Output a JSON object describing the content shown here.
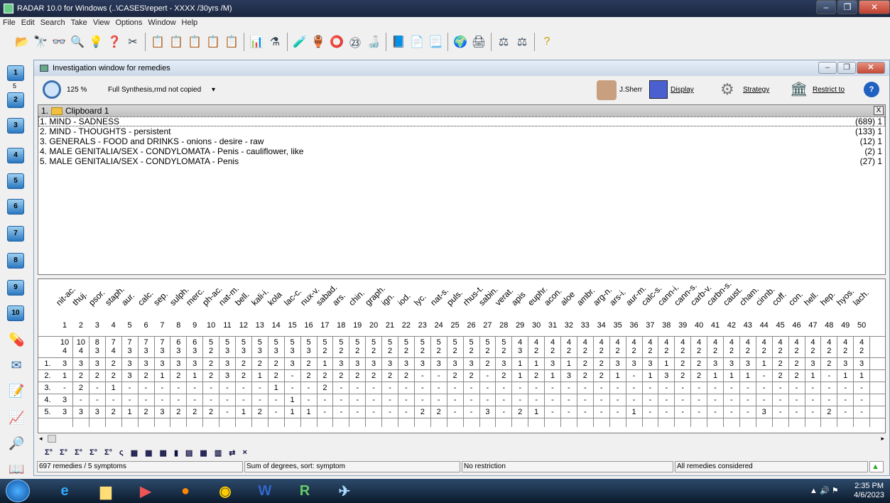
{
  "window": {
    "title": "RADAR 10.0 for Windows  (..\\CASES\\repert - XXXX /30yrs /M)"
  },
  "menu": [
    "File",
    "Edit",
    "Search",
    "Take",
    "View",
    "Options",
    "Window",
    "Help"
  ],
  "left_bar": {
    "clipboards": [
      "1",
      "2",
      "3",
      "4",
      "5",
      "6",
      "7",
      "8",
      "9",
      "10"
    ],
    "sub_label": "5"
  },
  "investigation": {
    "title": "Investigation window for remedies",
    "zoom": "125 %",
    "synthesis": "Full Synthesis,rmd not copied",
    "user": "J.Sherr",
    "display_label": "Display",
    "strategy_label": "Strategy",
    "restrict_label": "Restrict to"
  },
  "clipboard": {
    "header": "1.",
    "name": "Clipboard 1",
    "close": "X",
    "rubrics": [
      {
        "label": "1. MIND - SADNESS",
        "count": "(689) 1"
      },
      {
        "label": "2. MIND - THOUGHTS - persistent",
        "count": "(133) 1"
      },
      {
        "label": "3. GENERALS - FOOD and DRINKS - onions - desire - raw",
        "count": "(12) 1"
      },
      {
        "label": "4. MALE GENITALIA/SEX - CONDYLOMATA - Penis - cauliflower, like",
        "count": "(2) 1"
      },
      {
        "label": "5. MALE GENITALIA/SEX - CONDYLOMATA - Penis",
        "count": "(27) 1"
      }
    ]
  },
  "grid": {
    "remedies": [
      "nit-ac.",
      "thuj.",
      "psor.",
      "staph.",
      "aur.",
      "calc.",
      "sep.",
      "sulph.",
      "merc.",
      "ph-ac.",
      "nat-m.",
      "bell.",
      "kali-i.",
      "kola",
      "lac-c.",
      "nux-v.",
      "sabad.",
      "ars.",
      "chin.",
      "graph.",
      "ign.",
      "iod.",
      "lyc.",
      "nat-s.",
      "puls.",
      "rhus-t.",
      "sabin.",
      "verat.",
      "apis",
      "euphr.",
      "acon.",
      "aloe",
      "ambr.",
      "arg-n.",
      "ars-i.",
      "aur-m.",
      "calc-s.",
      "cann-i.",
      "cann-s.",
      "carb-v.",
      "carbn-s.",
      "caust.",
      "cham.",
      "cinnb.",
      "coff.",
      "con.",
      "hell.",
      "hep.",
      "hyos.",
      "lach."
    ],
    "numbers": [
      "1",
      "2",
      "3",
      "4",
      "5",
      "6",
      "7",
      "8",
      "9",
      "10",
      "11",
      "12",
      "13",
      "14",
      "15",
      "16",
      "17",
      "18",
      "19",
      "20",
      "21",
      "22",
      "23",
      "24",
      "25",
      "26",
      "27",
      "28",
      "29",
      "30",
      "31",
      "32",
      "33",
      "34",
      "35",
      "36",
      "37",
      "38",
      "39",
      "40",
      "41",
      "42",
      "43",
      "44",
      "45",
      "46",
      "47",
      "48",
      "49",
      "50"
    ],
    "sum_degrees": [
      "10",
      "10",
      "8",
      "7",
      "7",
      "7",
      "7",
      "6",
      "6",
      "5",
      "5",
      "5",
      "5",
      "5",
      "5",
      "5",
      "5",
      "5",
      "5",
      "5",
      "5",
      "5",
      "5",
      "5",
      "5",
      "5",
      "5",
      "5",
      "4",
      "4",
      "4",
      "4",
      "4",
      "4",
      "4",
      "4",
      "4",
      "4",
      "4",
      "4",
      "4",
      "4",
      "4",
      "4",
      "4",
      "4",
      "4",
      "4",
      "4",
      "4"
    ],
    "sum_symptoms": [
      "4",
      "4",
      "3",
      "4",
      "3",
      "3",
      "3",
      "3",
      "3",
      "2",
      "3",
      "3",
      "3",
      "3",
      "3",
      "3",
      "2",
      "2",
      "2",
      "2",
      "2",
      "2",
      "2",
      "2",
      "2",
      "2",
      "2",
      "2",
      "3",
      "2",
      "2",
      "2",
      "2",
      "2",
      "2",
      "2",
      "2",
      "2",
      "2",
      "2",
      "2",
      "2",
      "2",
      "2",
      "2",
      "2",
      "2",
      "2",
      "2",
      "2"
    ],
    "rows": [
      {
        "label": "1.",
        "cells": [
          "3",
          "3",
          "3",
          "2",
          "3",
          "3",
          "3",
          "3",
          "3",
          "2",
          "3",
          "2",
          "2",
          "2",
          "3",
          "2",
          "1",
          "3",
          "3",
          "3",
          "3",
          "3",
          "3",
          "3",
          "3",
          "3",
          "2",
          "3",
          "1",
          "1",
          "3",
          "1",
          "2",
          "2",
          "3",
          "3",
          "3",
          "1",
          "2",
          "2",
          "3",
          "3",
          "3",
          "1",
          "2",
          "2",
          "3",
          "2",
          "3",
          "3"
        ]
      },
      {
        "label": "2.",
        "cells": [
          "1",
          "2",
          "2",
          "2",
          "3",
          "2",
          "1",
          "2",
          "1",
          "2",
          "3",
          "2",
          "1",
          "2",
          "-",
          "2",
          "2",
          "2",
          "2",
          "2",
          "2",
          "2",
          "-",
          "-",
          "2",
          "2",
          "-",
          "2",
          "1",
          "2",
          "1",
          "3",
          "2",
          "2",
          "1",
          "-",
          "1",
          "3",
          "2",
          "2",
          "1",
          "1",
          "1",
          "-",
          "2",
          "2",
          "1",
          "-",
          "1",
          "1"
        ]
      },
      {
        "label": "3.",
        "cells": [
          "-",
          "2",
          "-",
          "1",
          "-",
          "-",
          "-",
          "-",
          "-",
          "-",
          "-",
          "-",
          "-",
          "1",
          "-",
          "-",
          "2",
          "-",
          "-",
          "-",
          "-",
          "-",
          "-",
          "-",
          "-",
          "-",
          "-",
          "-",
          "-",
          "-",
          "-",
          "-",
          "-",
          "-",
          "-",
          "-",
          "-",
          "-",
          "-",
          "-",
          "-",
          "-",
          "-",
          "-",
          "-",
          "-",
          "-",
          "-",
          "-",
          "-"
        ]
      },
      {
        "label": "4.",
        "cells": [
          "3",
          "-",
          "-",
          "-",
          "-",
          "-",
          "-",
          "-",
          "-",
          "-",
          "-",
          "-",
          "-",
          "-",
          "1",
          "-",
          "-",
          "-",
          "-",
          "-",
          "-",
          "-",
          "-",
          "-",
          "-",
          "-",
          "-",
          "-",
          "-",
          "-",
          "-",
          "-",
          "-",
          "-",
          "-",
          "-",
          "-",
          "-",
          "-",
          "-",
          "-",
          "-",
          "-",
          "-",
          "-",
          "-",
          "-",
          "-",
          "-",
          "-"
        ]
      },
      {
        "label": "5.",
        "cells": [
          "3",
          "3",
          "3",
          "2",
          "1",
          "2",
          "3",
          "2",
          "2",
          "2",
          "-",
          "1",
          "2",
          "-",
          "1",
          "1",
          "-",
          "-",
          "-",
          "-",
          "-",
          "-",
          "2",
          "2",
          "-",
          "-",
          "3",
          "-",
          "2",
          "1",
          "-",
          "-",
          "-",
          "-",
          "-",
          "1",
          "-",
          "-",
          "-",
          "-",
          "-",
          "-",
          "-",
          "3",
          "-",
          "-",
          "-",
          "2",
          "-",
          "-"
        ]
      }
    ]
  },
  "sum_toolbar": [
    "Σ°",
    "Σ°",
    "Σ°",
    "Σ°",
    "Σ°",
    "ς",
    "▦",
    "▦",
    "▦",
    "▮",
    "▤",
    "▦",
    "▥",
    "⇄",
    "×"
  ],
  "status": {
    "remedies": "697 remedies / 5 symptoms",
    "sort": "Sum of degrees, sort: symptom",
    "restriction": "No restriction",
    "considered": "All remedies considered"
  },
  "taskbar": {
    "time": "2:35 PM",
    "date": "4/6/2023"
  }
}
